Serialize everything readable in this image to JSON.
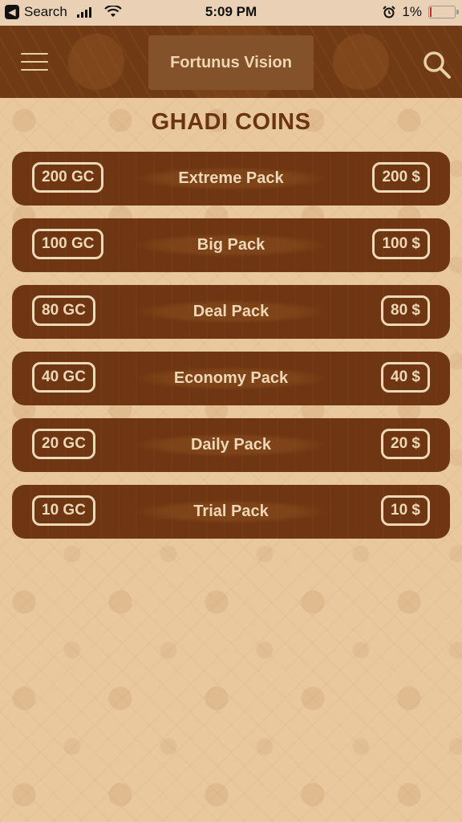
{
  "status_bar": {
    "back_label": "Search",
    "time": "5:09 PM",
    "battery_percent": "1%",
    "battery_level": 0.01,
    "icons": [
      "back-icon",
      "signal-icon",
      "wifi-icon",
      "alarm-icon",
      "battery-icon"
    ]
  },
  "nav": {
    "title": "Fortunus Vision",
    "menu_icon": "hamburger-menu-icon",
    "search_icon": "search-icon"
  },
  "page": {
    "title": "GHADI COINS"
  },
  "packs": [
    {
      "coins": "200 GC",
      "name": "Extreme Pack",
      "price": "200 $"
    },
    {
      "coins": "100 GC",
      "name": "Big Pack",
      "price": "100 $"
    },
    {
      "coins": "80 GC",
      "name": "Deal Pack",
      "price": "80 $"
    },
    {
      "coins": "40 GC",
      "name": "Economy Pack",
      "price": "40 $"
    },
    {
      "coins": "20 GC",
      "name": "Daily Pack",
      "price": "20 $"
    },
    {
      "coins": "10 GC",
      "name": "Trial Pack",
      "price": "10 $"
    }
  ],
  "colors": {
    "background": "#e9c89e",
    "nav_background": "#6f3a14",
    "row_background": "#6e3612",
    "accent_text": "#edd8b8",
    "title_text": "#6b3512"
  }
}
